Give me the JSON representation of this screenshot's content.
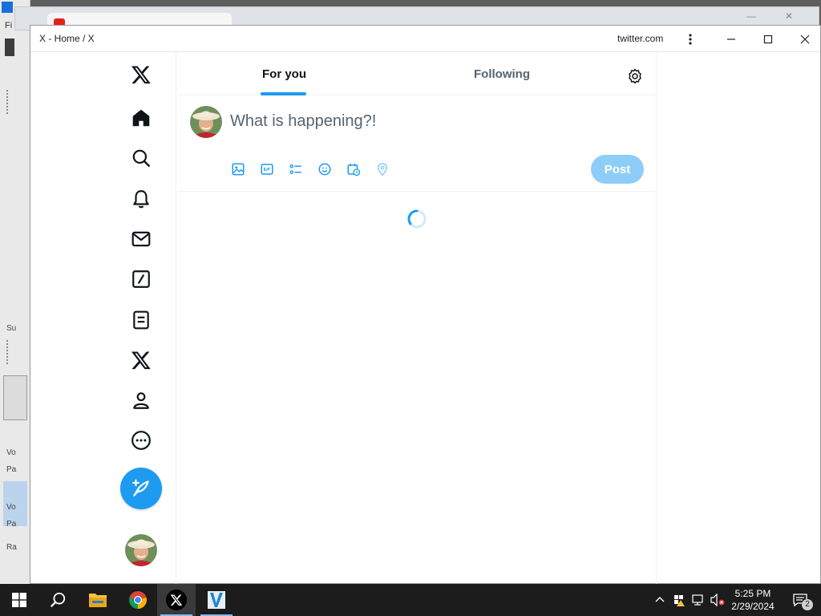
{
  "background": {
    "left_app_menu": "Fi",
    "left_labels": [
      "Su",
      "Vo",
      "Pa",
      "Vo",
      "Pa",
      "Ra"
    ],
    "colors": {
      "desktop": "#5e5e5e",
      "panel": "#e9e9e9"
    }
  },
  "window": {
    "title": "X - Home / X",
    "domain": "twitter.com",
    "menu_icon": "more-vertical-icon",
    "controls": [
      "minimize-icon",
      "maximize-icon",
      "close-icon"
    ]
  },
  "sidebar": {
    "logo": "x-logo-icon",
    "items": [
      {
        "name": "home",
        "icon": "home-icon"
      },
      {
        "name": "explore",
        "icon": "search-icon"
      },
      {
        "name": "notifications",
        "icon": "bell-icon"
      },
      {
        "name": "messages",
        "icon": "mail-icon"
      },
      {
        "name": "grok",
        "icon": "grok-icon"
      },
      {
        "name": "lists",
        "icon": "lists-icon"
      },
      {
        "name": "premium",
        "icon": "x-premium-icon"
      },
      {
        "name": "profile",
        "icon": "profile-icon"
      },
      {
        "name": "more",
        "icon": "more-circle-icon"
      }
    ],
    "compose_icon": "feather-plus-icon",
    "avatar": "user-avatar"
  },
  "main": {
    "tabs": [
      {
        "label": "For you",
        "active": true
      },
      {
        "label": "Following",
        "active": false
      }
    ],
    "settings_icon": "gear-icon",
    "composer": {
      "placeholder": "What is happening?!",
      "tools": [
        "image-icon",
        "gif-icon",
        "poll-icon",
        "emoji-icon",
        "schedule-icon",
        "location-icon"
      ],
      "post_label": "Post"
    },
    "loading": true
  },
  "taskbar": {
    "apps": [
      "windows-start-icon",
      "search-icon",
      "file-explorer-icon",
      "chrome-icon",
      "x-app-icon",
      "vegas-pro-icon"
    ],
    "active_app": "x-app-icon",
    "time": "5:25 PM",
    "date": "2/29/2024",
    "notification_count": "2"
  },
  "colors": {
    "accent": "#1d9bf0",
    "post_disabled": "#8ecdf8",
    "text_primary": "#0f1419",
    "text_secondary": "#536471"
  }
}
